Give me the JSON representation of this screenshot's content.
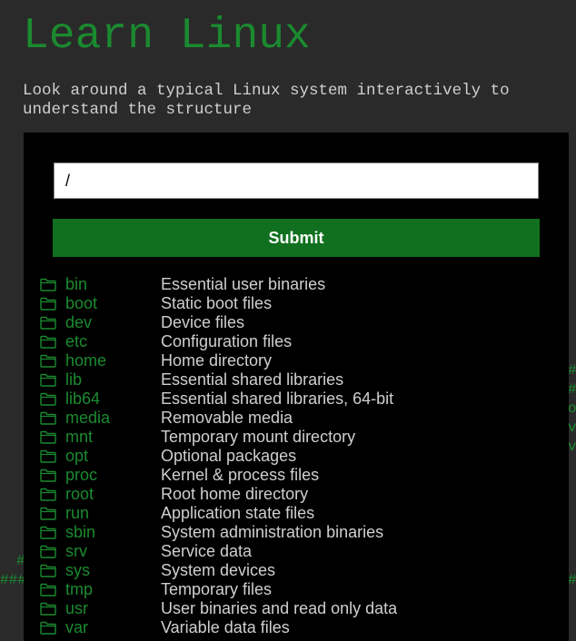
{
  "header": {
    "title": "Learn Linux",
    "subtitle": "Look around a typical Linux system interactively to understand the structure"
  },
  "form": {
    "path_value": "/",
    "submit_label": "Submit"
  },
  "directories": [
    {
      "name": "bin",
      "description": "Essential user binaries"
    },
    {
      "name": "boot",
      "description": "Static boot files"
    },
    {
      "name": "dev",
      "description": "Device files"
    },
    {
      "name": "etc",
      "description": "Configuration files"
    },
    {
      "name": "home",
      "description": "Home directory"
    },
    {
      "name": "lib",
      "description": "Essential shared libraries"
    },
    {
      "name": "lib64",
      "description": "Essential shared libraries, 64-bit"
    },
    {
      "name": "media",
      "description": "Removable media"
    },
    {
      "name": "mnt",
      "description": "Temporary mount directory"
    },
    {
      "name": "opt",
      "description": "Optional packages"
    },
    {
      "name": "proc",
      "description": "Kernel & process files"
    },
    {
      "name": "root",
      "description": "Root home directory"
    },
    {
      "name": "run",
      "description": "Application state files"
    },
    {
      "name": "sbin",
      "description": "System administration binaries"
    },
    {
      "name": "srv",
      "description": "Service data"
    },
    {
      "name": "sys",
      "description": "System devices"
    },
    {
      "name": "tmp",
      "description": "Temporary files"
    },
    {
      "name": "usr",
      "description": "User binaries and read only data"
    },
    {
      "name": "var",
      "description": "Variable data files"
    }
  ],
  "background_glyphs": {
    "right": [
      "#",
      "#",
      "o",
      "v",
      "v"
    ],
    "left": [
      "#",
      "###"
    ],
    "right_bottom": "#"
  },
  "colors": {
    "background": "#2a2a2a",
    "panel": "#000000",
    "accent_green": "#1b8a2f",
    "button_green": "#11701f",
    "text_light": "#cfcfcf"
  },
  "icons": {
    "directory": "folder-icon"
  }
}
